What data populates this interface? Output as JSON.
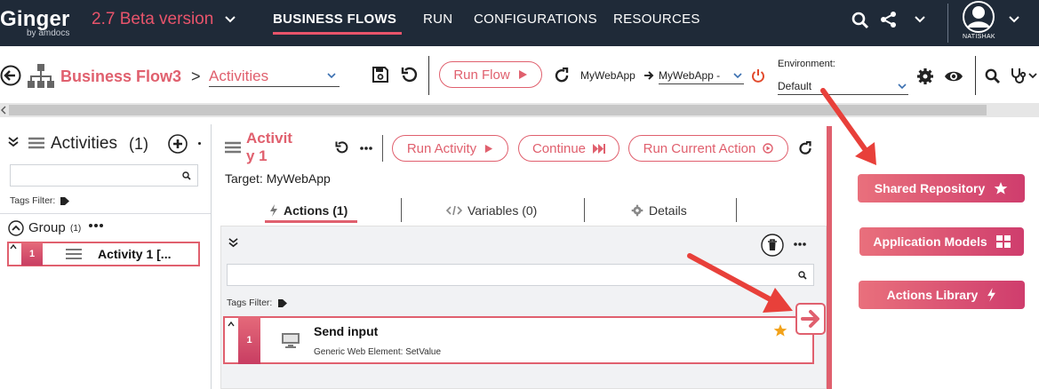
{
  "topbar": {
    "logo_name": "Ginger",
    "logo_sub": "by amdocs",
    "version": "2.7 Beta version",
    "nav": [
      "BUSINESS FLOWS",
      "RUN",
      "CONFIGURATIONS",
      "RESOURCES"
    ],
    "user": "NATISHAK"
  },
  "toolbar": {
    "business_flow": "Business Flow3",
    "crumb_sep": ">",
    "view_select": "Activities",
    "run_flow": "Run Flow",
    "app_name": "MyWebApp",
    "app_target": "MyWebApp -",
    "env_label": "Environment:",
    "env_value": "Default"
  },
  "left_panel": {
    "title": "Activities",
    "count": "(1)",
    "tags_filter": "Tags Filter:",
    "group_label": "Group",
    "group_count": "(1)",
    "activity_index": "1",
    "activity_label": "Activity 1 [..."
  },
  "activity": {
    "title_line1": "Activit",
    "title_line2": "y 1",
    "run_activity": "Run Activity",
    "continue": "Continue",
    "run_current_action": "Run Current Action",
    "target": "Target: MyWebApp",
    "tabs": [
      "Actions (1)",
      "Variables (0)",
      "Details"
    ],
    "tags_filter": "Tags Filter:",
    "action": {
      "index": "1",
      "title": "Send input",
      "subtitle": "Generic Web Element: SetValue"
    }
  },
  "right_panel": {
    "buttons": [
      "Shared Repository",
      "Application Models",
      "Actions Library"
    ]
  },
  "colors": {
    "accent": "#e0606e",
    "topbar": "#1f2a38",
    "arrow": "#e8403a",
    "star": "#f2a21a"
  }
}
